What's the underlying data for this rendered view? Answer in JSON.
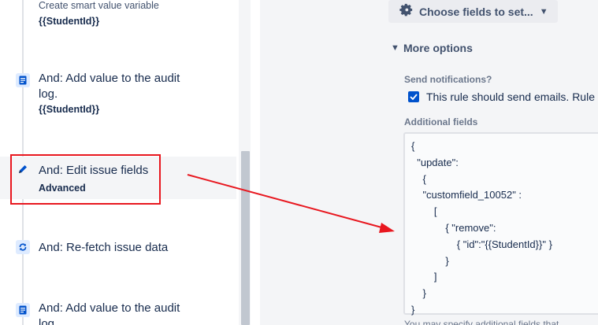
{
  "left_panel": {
    "steps": [
      {
        "title": "Create smart value variable",
        "sub": "{{StudentId}}"
      },
      {
        "title": "And: Add value to the audit",
        "title2": "log.",
        "sub": "{{StudentId}}",
        "icon": "document-icon"
      },
      {
        "title": "And: Edit issue fields",
        "sub": "Advanced",
        "icon": "pencil-icon"
      },
      {
        "title": "And: Re-fetch issue data",
        "icon": "refresh-icon"
      },
      {
        "title": "And: Add value to the audit",
        "title2": "log.",
        "icon": "document-icon"
      }
    ]
  },
  "right_panel": {
    "choose_fields_label": "Choose fields to set...",
    "more_options_label": "More options",
    "send_notifications_label": "Send notifications?",
    "send_emails_checkbox_label": "This rule should send emails. Rule a",
    "send_emails_checked": true,
    "additional_fields_label": "Additional fields",
    "additional_fields_value": "{\n  \"update\":\n    {\n    \"customfield_10052\" :\n        [\n            { \"remove\":\n                { \"id\":\"{{StudentId}}\" }\n            }\n        ]\n    }\n}",
    "bottom_hint": "You may specify additional fields that"
  },
  "colors": {
    "accent": "#0052cc",
    "annotation": "#e8171f",
    "selected_row": "#f4f5f7"
  }
}
